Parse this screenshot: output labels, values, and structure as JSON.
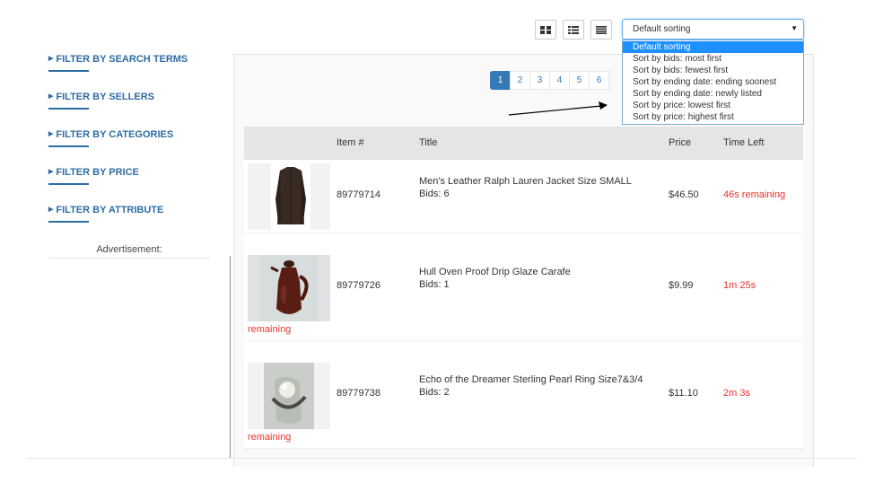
{
  "sidebar": {
    "filters": [
      "FILTER BY SEARCH TERMS",
      "FILTER BY SELLERS",
      "FILTER BY CATEGORIES",
      "FILTER BY PRICE",
      "FILTER BY ATTRIBUTE"
    ],
    "ad_label": "Advertisement:"
  },
  "sorting": {
    "current": "Default sorting",
    "options": [
      "Default sorting",
      "Sort by bids: most first",
      "Sort by bids: fewest first",
      "Sort by ending date: ending soonest",
      "Sort by ending date: newly listed",
      "Sort by price: lowest first",
      "Sort by price: highest first"
    ]
  },
  "pagination": {
    "pages": [
      "1",
      "2",
      "3",
      "4",
      "5",
      "6"
    ],
    "active": "1"
  },
  "table": {
    "headers": {
      "item": "Item #",
      "title": "Title",
      "price": "Price",
      "time": "Time Left"
    },
    "rows": [
      {
        "item": "89779714",
        "title": "Men's Leather Ralph Lauren Jacket Size SMALL",
        "bids": "Bids: 6",
        "price": "$46.50",
        "time": "46s remaining",
        "overflow": ""
      },
      {
        "item": "89779726",
        "title": "Hull Oven Proof Drip Glaze Carafe",
        "bids": "Bids: 1",
        "price": "$9.99",
        "time": "1m 25s",
        "overflow": "remaining"
      },
      {
        "item": "89779738",
        "title": "Echo of the Dreamer Sterling Pearl Ring Size7&3/4",
        "bids": "Bids: 2",
        "price": "$11.10",
        "time": "2m 3s",
        "overflow": "remaining"
      }
    ]
  },
  "colors": {
    "link": "#2e6da4",
    "time_left": "#e8322c",
    "active_page": "#337ab7",
    "selected_option": "#1e90ff"
  }
}
